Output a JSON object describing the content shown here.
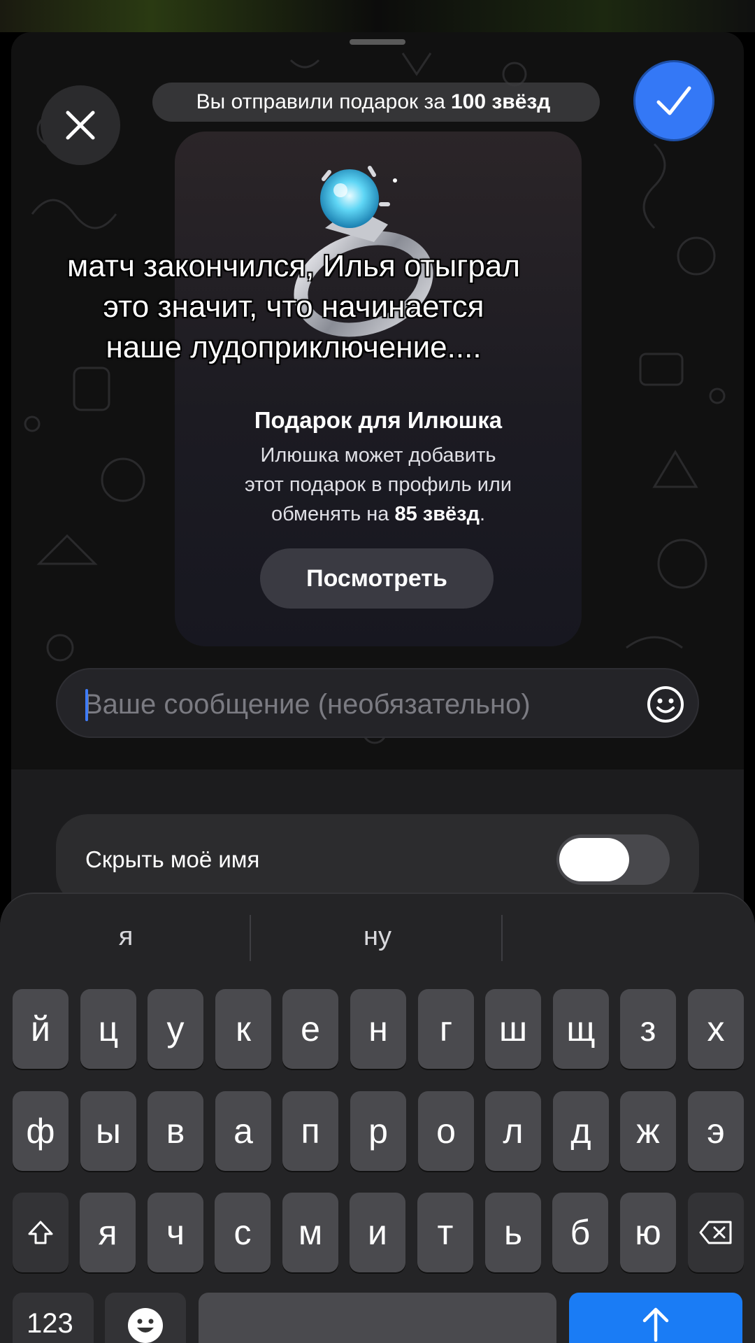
{
  "header": {
    "sent_prefix": "Вы отправили подарок за",
    "sent_amount": "100 звёзд"
  },
  "gift": {
    "title": "Подарок для Илюшка",
    "desc_line1": "Илюшка может добавить",
    "desc_line2": "этот подарок в профиль или",
    "desc_line3_prefix": "обменять на",
    "desc_line3_amount": "85 звёзд",
    "desc_line3_suffix": ".",
    "view_button": "Посмотреть"
  },
  "overlay": {
    "line1": "матч закончился, Илья отыграл",
    "line2": "это значит, что начинается",
    "line3": "наше лудоприключение...."
  },
  "message": {
    "placeholder": "Ваше сообщение (необязательно)",
    "value": ""
  },
  "settings": {
    "hide_name_label": "Скрыть моё имя",
    "hide_name_on": false
  },
  "keyboard": {
    "suggestions": [
      "я",
      "ну",
      ""
    ],
    "row1": [
      "й",
      "ц",
      "у",
      "к",
      "е",
      "н",
      "г",
      "ш",
      "щ",
      "з",
      "х"
    ],
    "row2": [
      "ф",
      "ы",
      "в",
      "а",
      "п",
      "р",
      "о",
      "л",
      "д",
      "ж",
      "э"
    ],
    "row3": [
      "я",
      "ч",
      "с",
      "м",
      "и",
      "т",
      "ь",
      "б",
      "ю"
    ],
    "numbers_key": "123",
    "send_key_icon": "arrow-up-icon",
    "shift_key_icon": "shift-icon",
    "delete_key_icon": "backspace-icon",
    "emoji_key_icon": "emoji-icon"
  },
  "colors": {
    "accent": "#3478f6",
    "send": "#1a7cf5",
    "key": "#4a4a4e"
  }
}
